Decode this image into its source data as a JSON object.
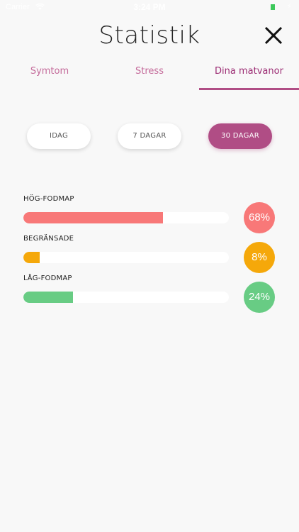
{
  "status_bar": {
    "carrier": "Carrier",
    "time": "3:24 PM"
  },
  "header": {
    "title": "Statistik"
  },
  "tabs": [
    {
      "label": "Symtom",
      "active": false
    },
    {
      "label": "Stress",
      "active": false
    },
    {
      "label": "Dina matvanor",
      "active": true
    }
  ],
  "periods": [
    {
      "label": "IDAG",
      "selected": false
    },
    {
      "label": "7 DAGAR",
      "selected": false
    },
    {
      "label": "30 DAGAR",
      "selected": true
    }
  ],
  "stats": [
    {
      "label": "HÖG-FODMAP",
      "percent_text": "68%",
      "value": 68,
      "color": "#f87878"
    },
    {
      "label": "BEGRÄNSADE",
      "percent_text": "8%",
      "value": 8,
      "color": "#f5a80a"
    },
    {
      "label": "LÅG-FODMAP",
      "percent_text": "24%",
      "value": 24,
      "color": "#68cc84"
    }
  ],
  "colors": {
    "accent": "#b04d85",
    "tab_text": "#c46a9a",
    "background": "#f8f8f8"
  },
  "icons": {
    "close": "close-icon",
    "wifi": "wifi-icon",
    "battery": "battery-icon"
  }
}
